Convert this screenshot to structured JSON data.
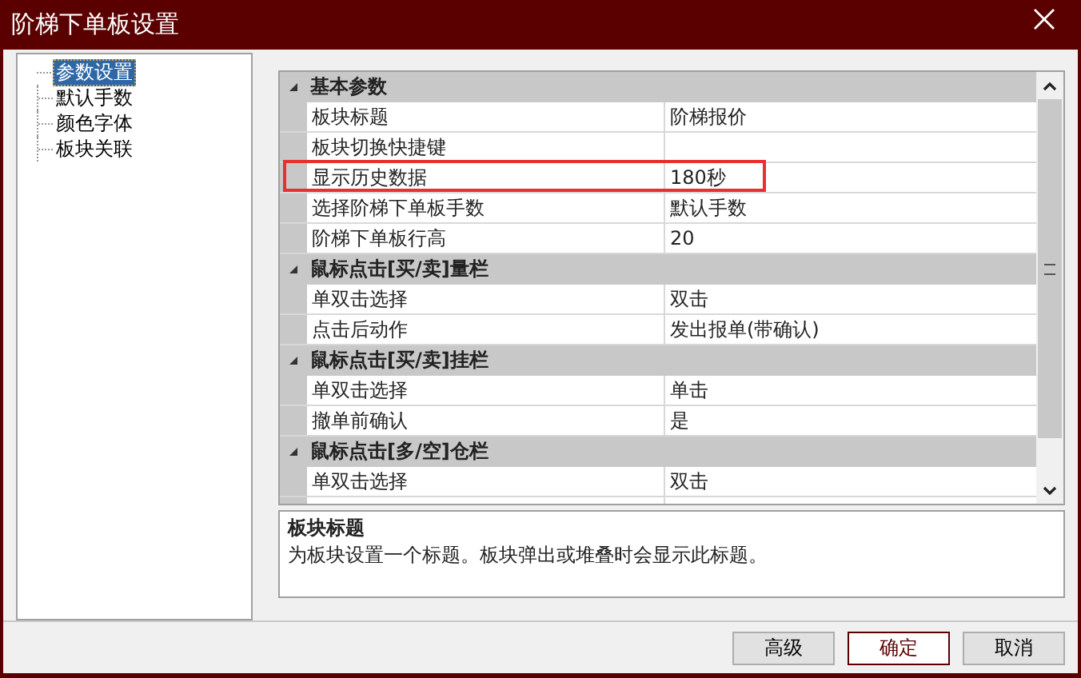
{
  "window": {
    "title": "阶梯下单板设置"
  },
  "tree": [
    {
      "label": "参数设置",
      "selected": true
    },
    {
      "label": "默认手数",
      "selected": false
    },
    {
      "label": "颜色字体",
      "selected": false
    },
    {
      "label": "板块关联",
      "selected": false
    }
  ],
  "grid": {
    "categories": [
      {
        "title": "基本参数",
        "expanded": true,
        "rows": [
          {
            "name": "板块标题",
            "value": "阶梯报价",
            "highlighted": false
          },
          {
            "name": "板块切换快捷键",
            "highlighted": false
          },
          {
            "name": "显示历史数据",
            "value": "180秒",
            "highlighted": true
          },
          {
            "name": "选择阶梯下单板手数",
            "value": "默认手数",
            "highlighted": false
          },
          {
            "name": "阶梯下单板行高",
            "value": "20",
            "highlighted": false
          }
        ]
      },
      {
        "title": "鼠标点击[买/卖]量栏",
        "expanded": true,
        "rows": [
          {
            "name": "单双击选择",
            "value": "双击",
            "highlighted": false
          },
          {
            "name": "点击后动作",
            "value": "发出报单(带确认)",
            "highlighted": false
          }
        ]
      },
      {
        "title": "鼠标点击[买/卖]挂栏",
        "expanded": true,
        "rows": [
          {
            "name": "单双击选择",
            "value": "单击",
            "highlighted": false
          },
          {
            "name": "撤单前确认",
            "value": "是",
            "highlighted": false
          }
        ]
      },
      {
        "title": "鼠标点击[多/空]仓栏",
        "expanded": true,
        "rows": [
          {
            "name": "单双击选择",
            "value": "双击",
            "highlighted": false
          },
          {
            "highlighted": false
          }
        ]
      }
    ]
  },
  "description": {
    "title": "板块标题",
    "text": "为板块设置一个标题。板块弹出或堆叠时会显示此标题。"
  },
  "buttons": [
    {
      "label": "高级",
      "default": false
    },
    {
      "label": "确定",
      "default": true
    },
    {
      "label": "取消",
      "default": false
    }
  ]
}
